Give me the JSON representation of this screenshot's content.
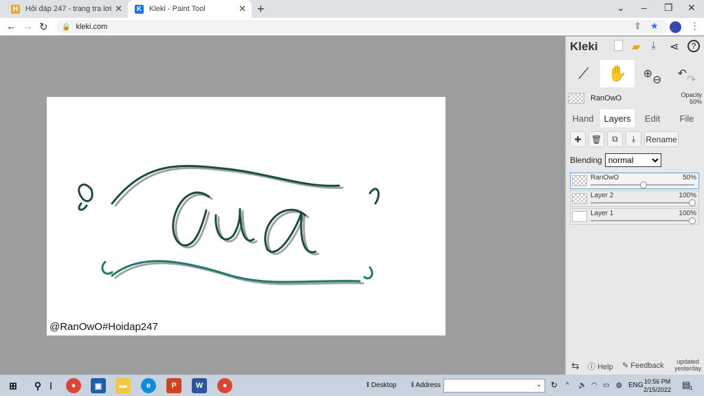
{
  "browser": {
    "tabs": [
      {
        "title": "Hỏi đáp 247 - trang tra lơi",
        "active": false
      },
      {
        "title": "Kleki - Paint Tool",
        "active": true
      }
    ],
    "url": "kleki.com"
  },
  "canvas": {
    "lettering": "Cua",
    "watermark": "@RanOwO#Hoidap247"
  },
  "panel": {
    "logo": "Kleki",
    "current_layer": "RanOwO",
    "opacity_label": "Opacity",
    "opacity_value": "50%",
    "tabs": [
      "Hand",
      "Layers",
      "Edit",
      "File"
    ],
    "active_tab": "Layers",
    "rename_label": "Rename",
    "blending_label": "Blending",
    "blending_value": "normal",
    "layers": [
      {
        "name": "RanOwO",
        "opacity": "50%",
        "opacity_value": 0.5,
        "active": true
      },
      {
        "name": "Layer 2",
        "opacity": "100%",
        "opacity_value": 1.0,
        "active": false
      },
      {
        "name": "Layer 1",
        "opacity": "100%",
        "opacity_value": 1.0,
        "active": false
      }
    ],
    "help_label": "Help",
    "feedback_label": "Feedback",
    "updated_label": "updated",
    "updated_when": "yesterday"
  },
  "taskbar": {
    "desktop_label": "Desktop",
    "address_label": "Address",
    "language": "ENG",
    "time": "10:56 PM",
    "date": "2/15/2022",
    "notification_count": "1"
  },
  "colors": {
    "stroke_dark": "#1d4a44",
    "stroke_teal": "#1f7a6e",
    "shadow": "#9aa3a3",
    "accent_blue": "#1a73e8"
  }
}
